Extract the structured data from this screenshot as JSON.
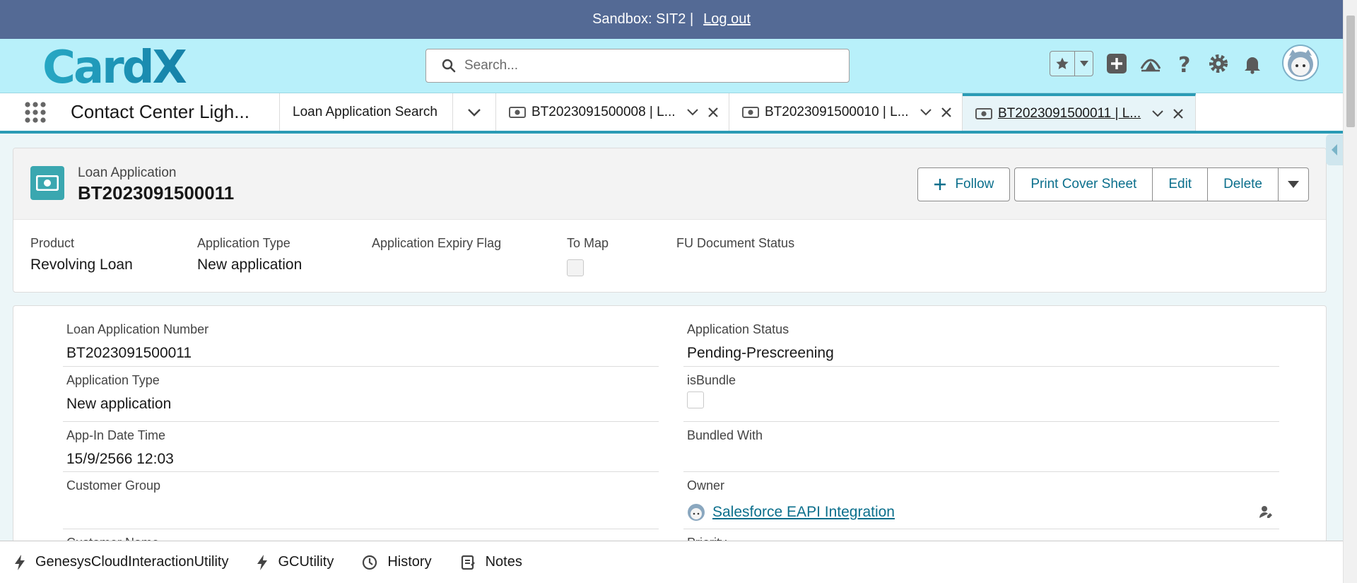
{
  "banner": {
    "text": "Sandbox: SIT2 |",
    "logout": "Log out"
  },
  "header": {
    "logo_text": "CardX",
    "search_placeholder": "Search...",
    "icons": [
      "star-icon",
      "chevron-down-icon",
      "plus-icon",
      "trailhead-icon",
      "help-icon",
      "setup-gear-icon",
      "notification-bell-icon",
      "avatar"
    ]
  },
  "nav": {
    "app_name": "Contact Center Ligh...",
    "tabs": [
      {
        "label": "Loan Application Search"
      },
      {
        "label": "BT2023091500008 | L..."
      },
      {
        "label": "BT2023091500010 | L..."
      },
      {
        "label": "BT2023091500011 | L..."
      }
    ]
  },
  "record": {
    "type": "Loan Application",
    "name": "BT2023091500011",
    "actions": {
      "follow": "Follow",
      "print": "Print Cover Sheet",
      "edit": "Edit",
      "delete": "Delete"
    },
    "highlights": [
      {
        "label": "Product",
        "value": "Revolving Loan"
      },
      {
        "label": "Application Type",
        "value": "New application"
      },
      {
        "label": "Application Expiry Flag",
        "value": ""
      },
      {
        "label": "To Map",
        "value": ""
      },
      {
        "label": "FU Document Status",
        "value": ""
      }
    ]
  },
  "details": {
    "loan_app_number": {
      "label": "Loan Application Number",
      "value": "BT2023091500011"
    },
    "application_status": {
      "label": "Application Status",
      "value": "Pending-Prescreening"
    },
    "application_type": {
      "label": "Application Type",
      "value": "New application"
    },
    "is_bundle": {
      "label": "isBundle"
    },
    "app_in_datetime": {
      "label": "App-In Date Time",
      "value": "15/9/2566 12:03"
    },
    "bundled_with": {
      "label": "Bundled With",
      "value": ""
    },
    "customer_group": {
      "label": "Customer Group",
      "value": ""
    },
    "owner": {
      "label": "Owner",
      "value": "Salesforce EAPI Integration"
    },
    "customer_name_partial": {
      "label": "Customer Name"
    },
    "priority_partial": {
      "label": "Priority"
    }
  },
  "utility_bar": [
    {
      "label": "GenesysCloudInteractionUtility",
      "icon": "lightning-icon"
    },
    {
      "label": "GCUtility",
      "icon": "lightning-icon"
    },
    {
      "label": "History",
      "icon": "clock-icon"
    },
    {
      "label": "Notes",
      "icon": "notes-icon"
    }
  ],
  "colors": {
    "banner": "#546a95",
    "header": "#b8f0fa",
    "brand": "#0b6f8c",
    "accent": "#2a9bb5"
  }
}
